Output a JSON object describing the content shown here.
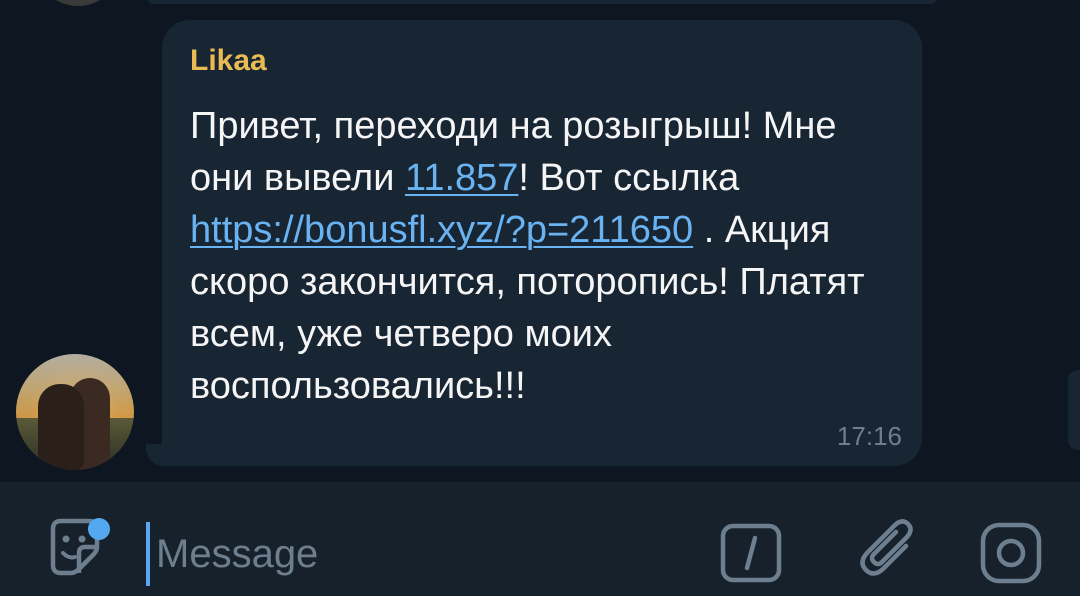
{
  "message": {
    "sender": "Likaa",
    "text_1": "Привет, переходи на розыгрыш! Мне они вывели ",
    "link_amount": "11.857",
    "text_2": "! Вот ссылка ",
    "link_url": "https://bonusfl.xyz/?p=211650",
    "text_3": " . Акция скоро закончится, поторопись! Платят всем, уже четверо моих воспользовались!!!",
    "time": "17:16"
  },
  "composer": {
    "placeholder": "Message"
  },
  "icons": {
    "sticker": "sticker-icon",
    "command": "bot-command-icon",
    "attach": "paperclip-icon",
    "camera": "camera-icon"
  },
  "colors": {
    "sender": "#e9bb52",
    "link": "#6ab3f3",
    "bubble": "#182533",
    "background": "#0e1621",
    "accent": "#54a8f0"
  }
}
